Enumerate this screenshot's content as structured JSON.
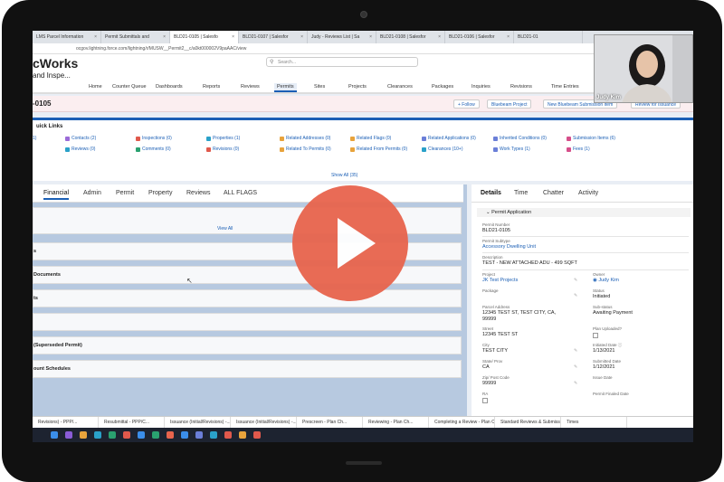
{
  "browser": {
    "tabs": [
      "LMS Parcel Information",
      "Permit Submittals and",
      "BLD21-0105 | Salesfo",
      "BLD21-0107 | Salesfor",
      "Judy - Reviews List | Sa",
      "BLD21-0108 | Salesfor",
      "BLD21-0106 | Salesfor",
      "BLD21-01"
    ],
    "url": "ocgov.lightning.force.com/lightning/r/MUSW__Permit2__c/a0kt000002V9paAAC/view"
  },
  "app": {
    "logo": "cWorks",
    "logo_sub": "and Inspe...",
    "search_placeholder": "Search...",
    "nav": [
      "Home",
      "Counter Queue",
      "Dashboards",
      "Reports",
      "Reviews",
      "Permits",
      "Sites",
      "Projects",
      "Clearances",
      "Packages",
      "Inquiries",
      "Revisions",
      "Time Entries"
    ]
  },
  "record": {
    "title": "-0105",
    "buttons": [
      "+ Follow",
      "Bluebeam Project",
      "New Bluebeam Submission Item",
      "Review for Issuance"
    ]
  },
  "quick_links": {
    "title": "uick Links",
    "items": [
      "Contacts (2)",
      "Inspections (0)",
      "Properties (1)",
      "Related Addresses (0)",
      "Related Flags (0)",
      "Related Applications (0)",
      "Inherited Conditions (0)",
      "Submission Items (6)",
      "Reviews (0)",
      "Comments (0)",
      "Revisions (0)",
      "Related To Permits (0)",
      "Related From Permits (0)",
      "Clearances (10+)",
      "Work Types (1)",
      "Fees (1)"
    ],
    "lead_1": "1)",
    "show_all": "Show All (35)"
  },
  "left_panel": {
    "tabs": [
      "Financial",
      "Admin",
      "Permit",
      "Property",
      "Reviews",
      "ALL FLAGS"
    ],
    "view_all": "View All",
    "cards": [
      "s",
      "Documents",
      "ts",
      "",
      "(Superseded Permit)",
      "ount Schedules"
    ]
  },
  "right_panel": {
    "tabs": [
      "Details",
      "Time",
      "Chatter",
      "Activity"
    ],
    "section": "Permit Application",
    "fields": {
      "permit_number_label": "Permit Number",
      "permit_number": "BLD21-0105",
      "subtype_label": "Permit Subtype",
      "subtype": "Accessory Dwelling Unit",
      "description_label": "Description",
      "description": "TEST - NEW ATTACHED ADU - 499 SQFT",
      "project_label": "Project",
      "project": "JK Test Projects",
      "owner_label": "Owner",
      "owner": "Judy Kim",
      "package_label": "Package",
      "status_label": "Status",
      "status": "Initiated",
      "parcel_label": "Parcel Address",
      "parcel_1": "12345 TEST ST, TEST CITY, CA,",
      "parcel_2": "99999",
      "substatus_label": "Sub-status",
      "substatus": "Awaiting Payment",
      "street_label": "Street",
      "street": "12345 TEST ST",
      "plans_label": "Plan Uploaded?",
      "city_label": "City",
      "city": "TEST CITY",
      "initiated_label": "Initiated Date",
      "initiated": "1/13/2021",
      "state_label": "State/ Prov",
      "state": "CA",
      "submitted_label": "Submitted Date",
      "submitted": "1/12/2021",
      "zip_label": "Zip/ Post Code",
      "zip": "99999",
      "issue_label": "Issue Date",
      "ra_label": "RA",
      "finaled_label": "Permit Finaled Date"
    }
  },
  "utility_bar": [
    "Revisions) - PPP/...",
    "Resubmittal - PPP/C...",
    "Issuance (Initial/Revisions) -...",
    "Issuance (Initial/Revisions) -...",
    "Prescreen - Plan Ch...",
    "Reviewing - Plan Ch...",
    "Completing a Review - Plan Ch...",
    "Standard Reviews & Submission B...",
    "Times"
  ],
  "video": {
    "name": "Judy Kim"
  },
  "colors": {
    "brand": "#1b5fb5",
    "play": "#e8644d"
  }
}
